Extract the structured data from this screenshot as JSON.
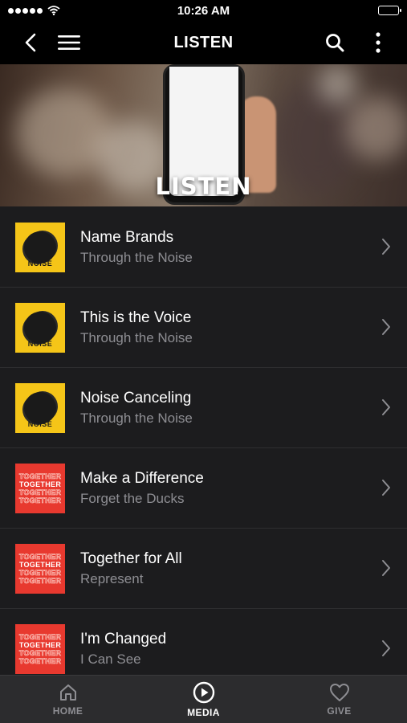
{
  "status_bar": {
    "time": "10:26 AM"
  },
  "nav": {
    "title": "LISTEN",
    "icons": [
      "back-icon",
      "menu-icon",
      "search-icon",
      "more-icon"
    ]
  },
  "hero": {
    "title": "LISTEN"
  },
  "items": [
    {
      "title": "Name Brands",
      "subtitle": "Through the Noise",
      "art": "noise",
      "art_word": "NOISE"
    },
    {
      "title": "This is the Voice",
      "subtitle": "Through the Noise",
      "art": "noise",
      "art_word": "NOISE"
    },
    {
      "title": "Noise Canceling",
      "subtitle": "Through the Noise",
      "art": "noise",
      "art_word": "NOISE"
    },
    {
      "title": "Make a Difference",
      "subtitle": "Forget the Ducks",
      "art": "together",
      "art_word": "TOGETHER"
    },
    {
      "title": "Together for All",
      "subtitle": "Represent",
      "art": "together",
      "art_word": "TOGETHER"
    },
    {
      "title": "I'm Changed",
      "subtitle": "I Can See",
      "art": "together",
      "art_word": "TOGETHER"
    }
  ],
  "tabs": [
    {
      "label": "HOME",
      "icon": "home-icon",
      "active": false
    },
    {
      "label": "MEDIA",
      "icon": "play-circle-icon",
      "active": true
    },
    {
      "label": "GIVE",
      "icon": "heart-icon",
      "active": false
    }
  ],
  "colors": {
    "noise_art": "#f5c518",
    "together_art": "#e8392f",
    "background": "#1c1c1e",
    "bar": "#000000",
    "tab_bar": "#2c2c2e",
    "subtitle": "#8e8e93"
  }
}
